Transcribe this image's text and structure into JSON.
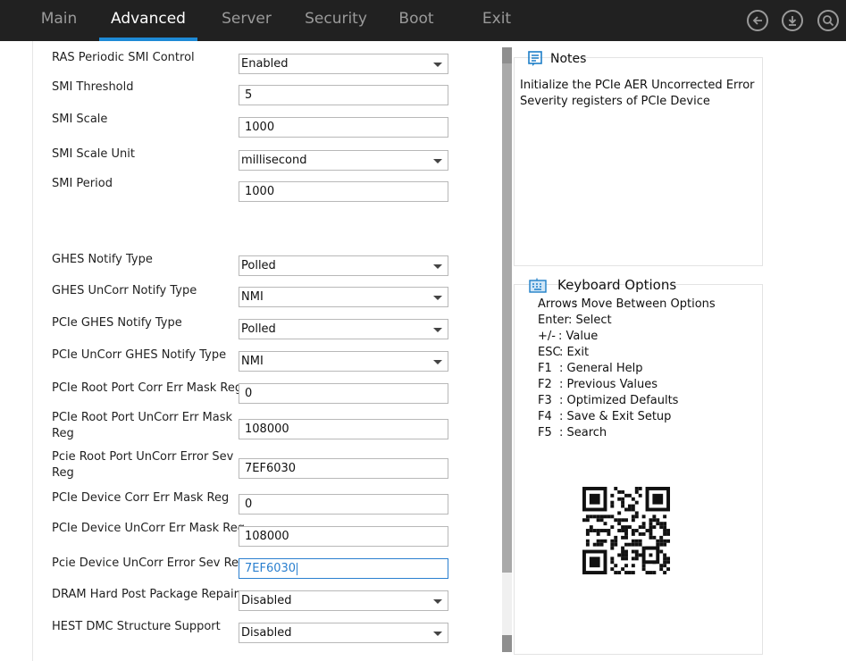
{
  "nav": {
    "tabs": [
      {
        "label": "Main",
        "active": false
      },
      {
        "label": "Advanced",
        "active": true
      },
      {
        "label": "Server",
        "active": false
      },
      {
        "label": "Security",
        "active": false
      },
      {
        "label": "Boot",
        "active": false
      },
      {
        "label": "Exit",
        "active": false
      }
    ],
    "icons": [
      "back-icon",
      "save-download-icon",
      "search-icon"
    ]
  },
  "settings": [
    {
      "label": "RAS Periodic SMI Control",
      "value": "Enabled",
      "type": "select"
    },
    {
      "label": "SMI Threshold",
      "value": "5",
      "type": "input"
    },
    {
      "label": "SMI Scale",
      "value": "1000",
      "type": "input"
    },
    {
      "label": "SMI Scale Unit",
      "value": "millisecond",
      "type": "select"
    },
    {
      "label": "SMI Period",
      "value": "1000",
      "type": "input"
    },
    {
      "label": "GHES Notify Type",
      "value": "Polled",
      "type": "select"
    },
    {
      "label": "GHES UnCorr Notify Type",
      "value": "NMI",
      "type": "select"
    },
    {
      "label": "PCIe GHES Notify Type",
      "value": "Polled",
      "type": "select"
    },
    {
      "label": "PCIe UnCorr GHES Notify Type",
      "value": "NMI",
      "type": "select"
    },
    {
      "label": "PCIe Root Port Corr Err Mask Reg",
      "value": "0",
      "type": "input"
    },
    {
      "label": "PCIe Root Port UnCorr Err Mask Reg",
      "value": "108000",
      "type": "input"
    },
    {
      "label": "Pcie Root Port UnCorr Error Sev Reg",
      "value": "7EF6030",
      "type": "input"
    },
    {
      "label": "PCIe Device Corr Err Mask Reg",
      "value": "0",
      "type": "input"
    },
    {
      "label": "PCIe Device UnCorr Err Mask Reg",
      "value": "108000",
      "type": "input"
    },
    {
      "label": "Pcie Device UnCorr Error Sev Reg",
      "value": "7EF6030",
      "type": "input",
      "focused": true
    },
    {
      "label": "DRAM Hard Post Package Repair",
      "value": "Disabled",
      "type": "select"
    },
    {
      "label": "HEST DMC Structure Support",
      "value": "Disabled",
      "type": "select"
    }
  ],
  "notes": {
    "title": "Notes",
    "text": "Initialize the PCIe AER Uncorrected Error Severity registers of PCIe Device"
  },
  "keyboard": {
    "title": "Keyboard Options",
    "keys": [
      {
        "key": "Arrows",
        "desc": ": Move Between Options"
      },
      {
        "key": "Enter",
        "desc": ": Select"
      },
      {
        "key": "+/-",
        "desc": ": Value"
      },
      {
        "key": "ESC",
        "desc": ": Exit"
      },
      {
        "key": "F1",
        "desc": ": General Help"
      },
      {
        "key": "F2",
        "desc": ": Previous Values"
      },
      {
        "key": "F3",
        "desc": ": Optimized Defaults"
      },
      {
        "key": "F4",
        "desc": ": Save & Exit Setup"
      },
      {
        "key": "F5",
        "desc": ": Search"
      }
    ]
  },
  "colors": {
    "topbar": "#212121",
    "accent": "#1e8ad6",
    "focus": "#2a7fcf"
  }
}
